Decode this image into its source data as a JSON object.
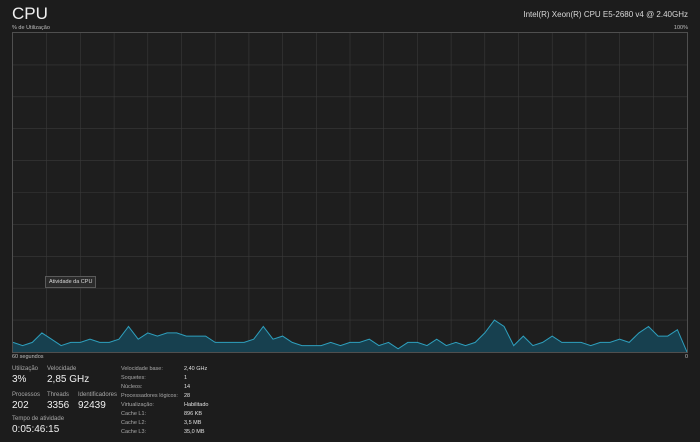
{
  "header": {
    "title": "CPU",
    "cpu_model": "Intel(R) Xeon(R) CPU E5-2680 v4 @ 2.40GHz"
  },
  "graph": {
    "y_label": "% de Utilização",
    "y_max": "100%",
    "x_label": "60 segundos",
    "y_min": "0",
    "tooltip": "Atividade da CPU",
    "fill_color": "#17404f",
    "line_color": "#2e9fbd"
  },
  "chart_data": {
    "type": "area",
    "y_range": [
      0,
      100
    ],
    "x_range": [
      60,
      0
    ],
    "values": [
      3,
      2,
      3,
      6,
      4,
      2,
      3,
      3,
      4,
      3,
      3,
      4,
      8,
      4,
      6,
      5,
      6,
      6,
      5,
      5,
      5,
      3,
      3,
      3,
      3,
      4,
      8,
      4,
      5,
      3,
      2,
      2,
      2,
      3,
      2,
      3,
      3,
      4,
      2,
      3,
      1,
      3,
      3,
      2,
      4,
      2,
      3,
      2,
      3,
      6,
      10,
      8,
      2,
      5,
      2,
      3,
      5,
      3,
      3,
      3,
      2,
      3,
      3,
      4,
      3,
      6,
      8,
      5,
      5,
      7,
      0
    ]
  },
  "stats": {
    "utilization": {
      "label": "Utilização",
      "value": "3%"
    },
    "speed": {
      "label": "Velocidade",
      "value": "2,85 GHz"
    },
    "processes": {
      "label": "Processos",
      "value": "202"
    },
    "threads": {
      "label": "Threads",
      "value": "3356"
    },
    "handles": {
      "label": "Identificadores",
      "value": "92439"
    },
    "uptime": {
      "label": "Tempo de atividade",
      "value": "0:05:46:15"
    }
  },
  "details": [
    {
      "key": "Velocidade base:",
      "value": "2,40 GHz"
    },
    {
      "key": "Soquetes:",
      "value": "1"
    },
    {
      "key": "Núcleos:",
      "value": "14"
    },
    {
      "key": "Processadores lógicos:",
      "value": "28"
    },
    {
      "key": "Virtualização:",
      "value": "Habilitado"
    },
    {
      "key": "Cache L1:",
      "value": "896 KB"
    },
    {
      "key": "Cache L2:",
      "value": "3,5 MB"
    },
    {
      "key": "Cache L3:",
      "value": "35,0 MB"
    }
  ]
}
